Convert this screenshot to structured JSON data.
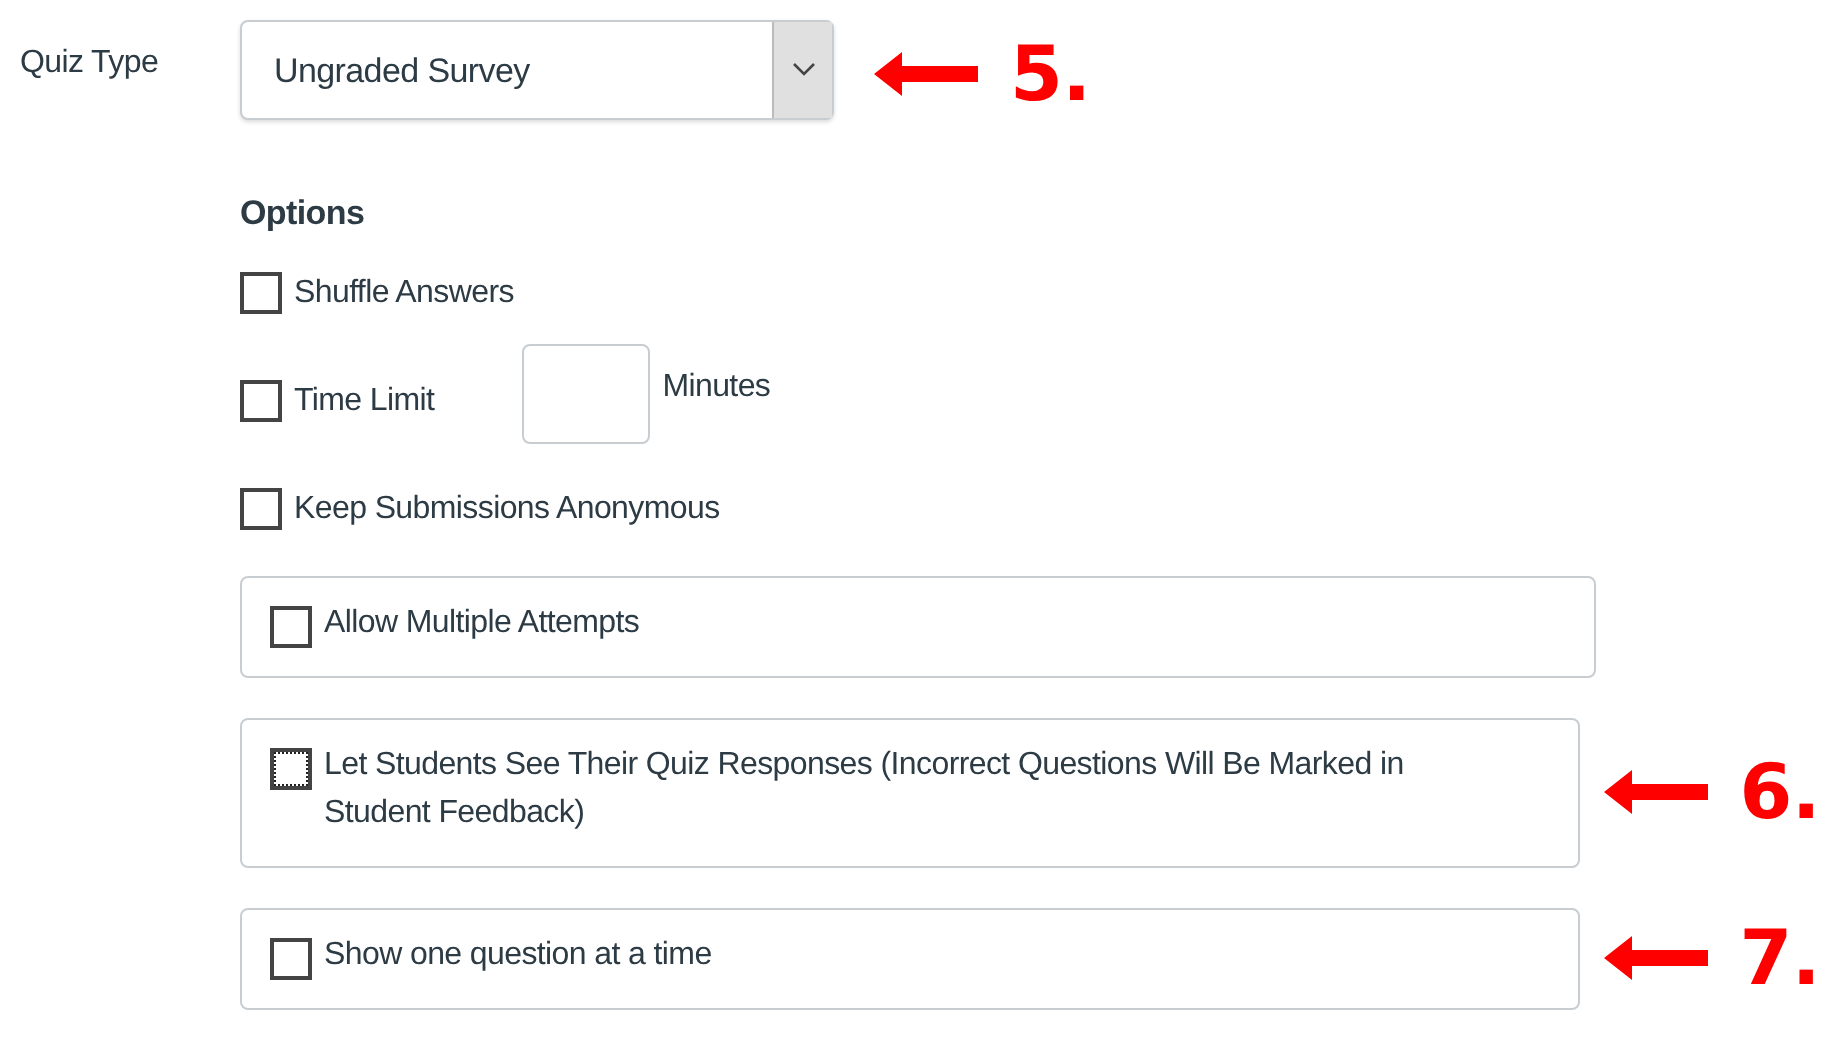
{
  "quiz_type": {
    "label": "Quiz Type",
    "value": "Ungraded Survey",
    "annotation": "5."
  },
  "options_heading": "Options",
  "options": [
    {
      "kind": "plain",
      "label": "Shuffle Answers",
      "checked": false,
      "focused": false
    },
    {
      "kind": "time",
      "label": "Time Limit",
      "unit": "Minutes",
      "checked": false,
      "focused": false
    },
    {
      "kind": "plain",
      "label": "Keep Submissions Anonymous",
      "checked": false,
      "focused": false
    },
    {
      "kind": "panel",
      "label": "Allow Multiple Attempts",
      "checked": false,
      "focused": false
    },
    {
      "kind": "panel",
      "label": "Let Students See Their Quiz Responses (Incorrect Questions Will Be Marked in Student Feedback)",
      "checked": false,
      "focused": true,
      "annotation": "6."
    },
    {
      "kind": "panel",
      "label": "Show one question at a time",
      "checked": false,
      "focused": false,
      "annotation": "7."
    }
  ]
}
